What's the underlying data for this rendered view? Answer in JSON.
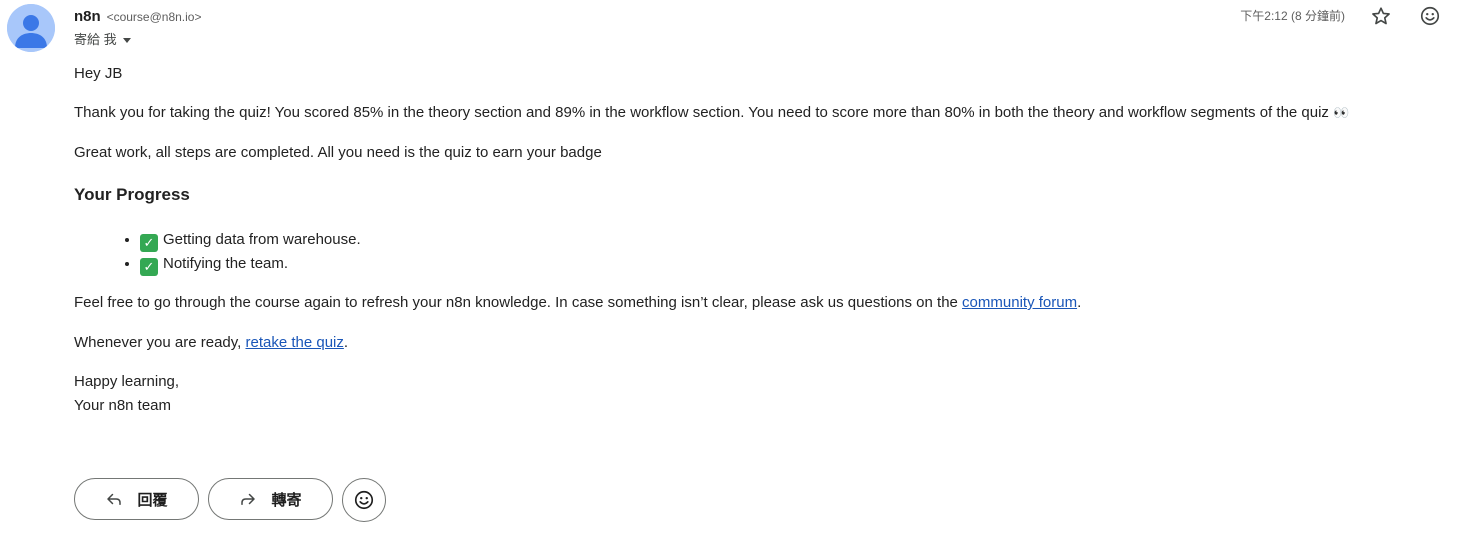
{
  "sender": {
    "name": "n8n",
    "email": "<course@n8n.io>"
  },
  "recipient": {
    "label": "寄給 我"
  },
  "timestamp": "下午2:12 (8 分鐘前)",
  "body": {
    "greeting": "Hey JB",
    "para1": "Thank you for taking the quiz! You scored 85% in the theory section and 89% in the workflow section. You need to score more than 80% in both the theory and workflow segments of the quiz",
    "para1_emoji": "👀",
    "para2": "Great work, all steps are completed. All you need is the quiz to earn your badge",
    "progress_heading": "Your Progress",
    "progress_items": [
      "Getting data from warehouse.",
      "Notifying the team."
    ],
    "para3_before": "Feel free to go through the course again to refresh your n8n knowledge. In case something isn’t clear, please ask us questions on the ",
    "para3_link": "community forum",
    "para3_after": ".",
    "para4_before": "Whenever you are ready, ",
    "para4_link": "retake the quiz",
    "para4_after": ".",
    "signoff_line1": "Happy learning,",
    "signoff_line2": "Your n8n team"
  },
  "actions": {
    "reply_label": "回覆",
    "forward_label": "轉寄"
  },
  "icons": {
    "avatar": "person-avatar-icon",
    "star": "star-outline-icon",
    "emoji": "smiley-icon",
    "reply": "reply-arrow-icon",
    "forward": "forward-arrow-icon",
    "check": "check-mark-icon"
  },
  "colors": {
    "avatar_bg": "#a8c7fa",
    "avatar_fg": "#1a73e8",
    "link": "#1a56b8",
    "check": "#34a853"
  }
}
